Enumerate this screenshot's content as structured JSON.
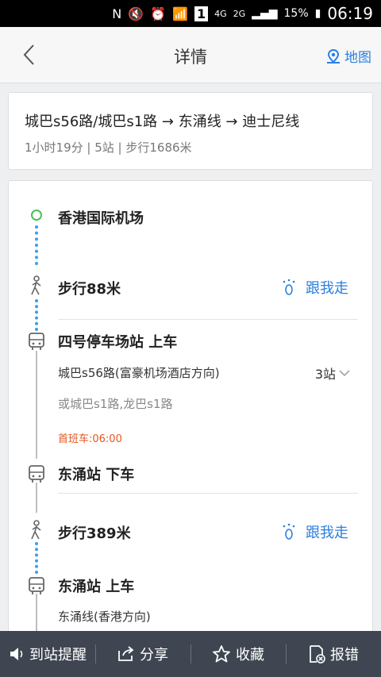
{
  "status_bar": {
    "battery": "15%",
    "time": "06:19",
    "net1": "4G",
    "net2": "2G",
    "badge": "1"
  },
  "header": {
    "title": "详情",
    "map_label": "地图"
  },
  "summary": {
    "route": "城巴s56路/城巴s1路 → 东涌线 → 迪士尼线",
    "meta": "1小时19分  |  5站  |  步行1686米"
  },
  "steps": {
    "start": "香港国际机场",
    "walk1": "步行88米",
    "follow_label": "跟我走",
    "board1": "四号停车场站 上车",
    "bus1_line": "城巴s56路(富豪机场酒店方向)",
    "bus1_stops": "3站",
    "bus1_alt": "或城巴s1路,龙巴s1路",
    "bus1_first": "首班车:06:00",
    "alight1": "东涌站 下车",
    "walk2": "步行389米",
    "board2": "东涌站 上车",
    "line2": "东涌线(香港方向)"
  },
  "bottom_bar": {
    "remind": "到站提醒",
    "share": "分享",
    "favorite": "收藏",
    "report": "报错"
  },
  "colors": {
    "accent": "#2a7fe0",
    "walk_dots": "#3aa0e6",
    "start": "#48c156",
    "first_bus": "#e6561f",
    "bottom_bg": "#3f4651"
  }
}
